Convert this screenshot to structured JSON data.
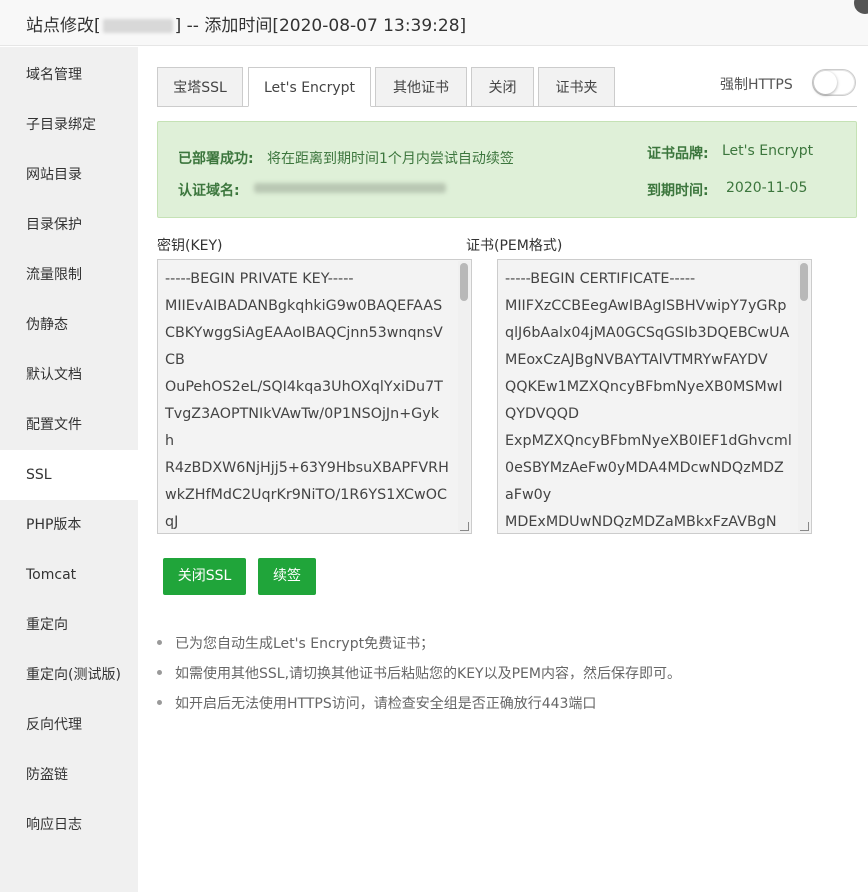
{
  "window": {
    "title_prefix": "站点修改[",
    "title_suffix": "] -- 添加时间[2020-08-07 13:39:28]"
  },
  "sidebar": {
    "items": [
      {
        "label": "域名管理"
      },
      {
        "label": "子目录绑定"
      },
      {
        "label": "网站目录"
      },
      {
        "label": "目录保护"
      },
      {
        "label": "流量限制"
      },
      {
        "label": "伪静态"
      },
      {
        "label": "默认文档"
      },
      {
        "label": "配置文件"
      },
      {
        "label": "SSL"
      },
      {
        "label": "PHP版本"
      },
      {
        "label": "Tomcat"
      },
      {
        "label": "重定向"
      },
      {
        "label": "重定向(测试版)"
      },
      {
        "label": "反向代理"
      },
      {
        "label": "防盗链"
      },
      {
        "label": "响应日志"
      }
    ],
    "active_index": 8
  },
  "tabs": [
    {
      "label": "宝塔SSL"
    },
    {
      "label": "Let's Encrypt"
    },
    {
      "label": "其他证书"
    },
    {
      "label": "关闭"
    },
    {
      "label": "证书夹"
    }
  ],
  "active_tab": "Let's Encrypt",
  "force_https": {
    "label": "强制HTTPS",
    "enabled": false
  },
  "status": {
    "deployed_label": "已部署成功:",
    "deployed_text": "将在距离到期时间1个月内尝试自动续签",
    "domain_label": "认证域名:",
    "brand_label": "证书品牌:",
    "brand_value": "Let's Encrypt",
    "expire_label": "到期时间:",
    "expire_value": "2020-11-05"
  },
  "key": {
    "label": "密钥(KEY)",
    "value": "-----BEGIN PRIVATE KEY-----\nMIIEvAIBADANBgkqhkiG9w0BAQEFAAS\nCBKYwggSiAgEAAoIBAQCjnn53wnqnsV\nCB\nOuPehOS2eL/SQI4kqa3UhOXqlYxiDu7T\nTvgZ3AOPTNIkVAwTw/0P1NSOjJn+Gyk\nh\nR4zBDXW6NjHjj5+63Y9HbsuXBAPFVRH\nwkZHfMdC2UqrKr9NiTO/1R6YS1XCwOC\nqJ"
  },
  "cert": {
    "label": "证书(PEM格式)",
    "value": "-----BEGIN CERTIFICATE-----\nMIIFXzCCBEegAwIBAgISBHVwipY7yGRp\nqlJ6bAalx04jMA0GCSqGSIb3DQEBCwUA\nMEoxCzAJBgNVBAYTAlVTMRYwFAYDV\nQQKEw1MZXQncyBFbmNyeXB0MSMwI\nQYDVQQD\nExpMZXQncyBFbmNyeXB0IEF1dGhvcml\n0eSBYMzAeFw0yMDA4MDcwNDQzMDZ\naFw0y\nMDExMDUwNDQzMDZaMBkxFzAVBgN"
  },
  "buttons": {
    "close_ssl": "关闭SSL",
    "renew": "续签"
  },
  "tips": [
    "已为您自动生成Let's Encrypt免费证书；",
    "如需使用其他SSL,请切换其他证书后粘贴您的KEY以及PEM内容，然后保存即可。",
    "如开启后无法使用HTTPS访问，请检查安全组是否正确放行443端口"
  ],
  "colors": {
    "primary_green": "#20a53a",
    "status_bg": "#dff0d8",
    "status_text": "#3c763d",
    "sidebar_bg": "#f0f0f0"
  }
}
